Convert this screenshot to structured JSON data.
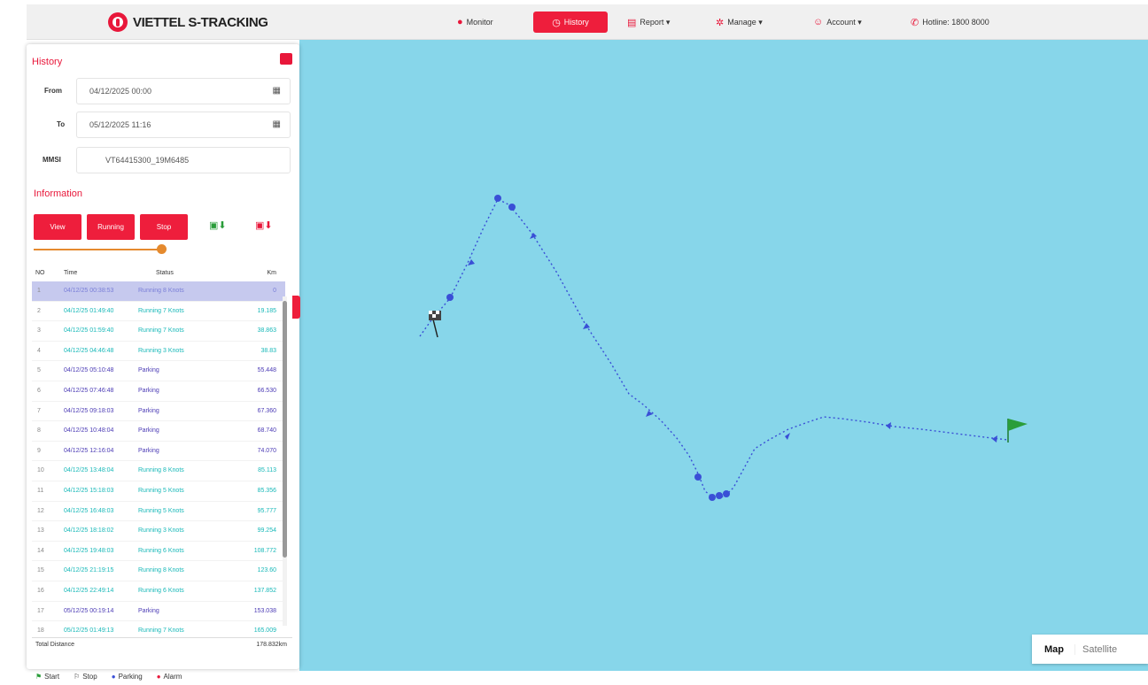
{
  "app": {
    "title": "VIETTEL S-TRACKING"
  },
  "nav": [
    {
      "label": "Monitor",
      "icon": "globe-icon"
    },
    {
      "label": "History",
      "icon": "clock-icon",
      "active": true
    },
    {
      "label": "Report ▾",
      "icon": "report-icon"
    },
    {
      "label": "Manage ▾",
      "icon": "gear-icon"
    },
    {
      "label": "Account ▾",
      "icon": "user-icon"
    },
    {
      "label": "Hotline: 1800 8000",
      "icon": "phone-icon"
    }
  ],
  "history": {
    "title": "History",
    "from_label": "From",
    "from_value": "04/12/2025 00:00",
    "to_label": "To",
    "to_value": "05/12/2025 11:16",
    "device_label": "MMSI",
    "device_value": "VT64415300_19M6485",
    "info_title": "Information",
    "buttons": {
      "view": "View",
      "running": "Running",
      "stop": "Stop"
    },
    "table_headers": {
      "no": "NO",
      "time": "Time",
      "status": "Status",
      "km": "Km"
    },
    "rows": [
      {
        "no": "1",
        "time": "04/12/25 00:38:53",
        "status": "Running 8 Knots",
        "km": "0",
        "kind": "sel"
      },
      {
        "no": "2",
        "time": "04/12/25 01:49:40",
        "status": "Running 7 Knots",
        "km": "19.185",
        "kind": "run"
      },
      {
        "no": "3",
        "time": "04/12/25 01:59:40",
        "status": "Running 7 Knots",
        "km": "38.863",
        "kind": "run"
      },
      {
        "no": "4",
        "time": "04/12/25 04:46:48",
        "status": "Running 3 Knots",
        "km": "38.83",
        "kind": "run"
      },
      {
        "no": "5",
        "time": "04/12/25 05:10:48",
        "status": "Parking",
        "km": "55.448",
        "kind": "park"
      },
      {
        "no": "6",
        "time": "04/12/25 07:46:48",
        "status": "Parking",
        "km": "66.530",
        "kind": "park"
      },
      {
        "no": "7",
        "time": "04/12/25 09:18:03",
        "status": "Parking",
        "km": "67.360",
        "kind": "park"
      },
      {
        "no": "8",
        "time": "04/12/25 10:48:04",
        "status": "Parking",
        "km": "68.740",
        "kind": "park"
      },
      {
        "no": "9",
        "time": "04/12/25 12:16:04",
        "status": "Parking",
        "km": "74.070",
        "kind": "park"
      },
      {
        "no": "10",
        "time": "04/12/25 13:48:04",
        "status": "Running 8 Knots",
        "km": "85.113",
        "kind": "run"
      },
      {
        "no": "11",
        "time": "04/12/25 15:18:03",
        "status": "Running 5 Knots",
        "km": "85.356",
        "kind": "run"
      },
      {
        "no": "12",
        "time": "04/12/25 16:48:03",
        "status": "Running 5 Knots",
        "km": "95.777",
        "kind": "run"
      },
      {
        "no": "13",
        "time": "04/12/25 18:18:02",
        "status": "Running 3 Knots",
        "km": "99.254",
        "kind": "run"
      },
      {
        "no": "14",
        "time": "04/12/25 19:48:03",
        "status": "Running 6 Knots",
        "km": "108.772",
        "kind": "run"
      },
      {
        "no": "15",
        "time": "04/12/25 21:19:15",
        "status": "Running 8 Knots",
        "km": "123.60",
        "kind": "run"
      },
      {
        "no": "16",
        "time": "04/12/25 22:49:14",
        "status": "Running 6 Knots",
        "km": "137.852",
        "kind": "run"
      },
      {
        "no": "17",
        "time": "05/12/25 00:19:14",
        "status": "Parking",
        "km": "153.038",
        "kind": "park"
      },
      {
        "no": "18",
        "time": "05/12/25 01:49:13",
        "status": "Running 7 Knots",
        "km": "165.009",
        "kind": "run"
      }
    ],
    "total_label": "Total Distance",
    "total_value": "178.832km"
  },
  "map": {
    "map_label": "Map",
    "satellite_label": "Satellite"
  },
  "legend": {
    "start": "Start",
    "stop": "Stop",
    "parking": "Parking",
    "alarm": "Alarm"
  },
  "colors": {
    "accent": "#ee1e3c",
    "route": "#3a4fd6",
    "sea": "#87d6ea"
  }
}
